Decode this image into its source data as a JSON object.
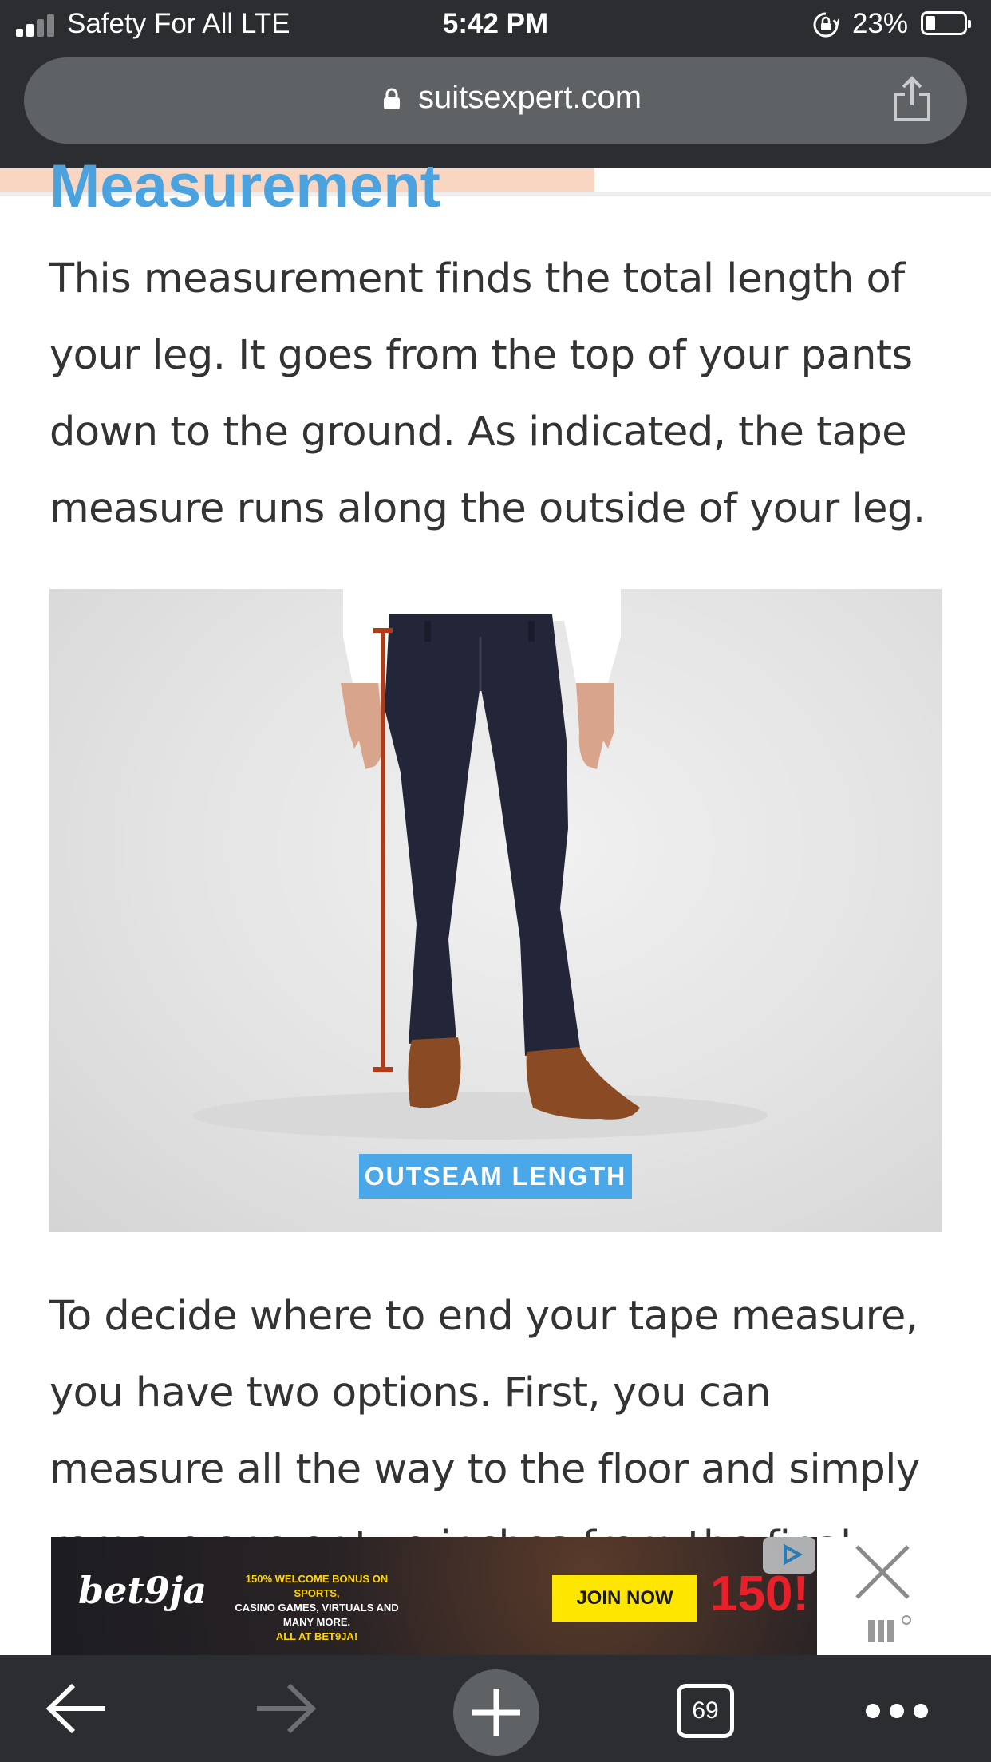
{
  "status_bar": {
    "carrier": "Safety For All  LTE",
    "time": "5:42 PM",
    "battery_percent": "23%",
    "battery_level": 0.23,
    "signal_bars": 2
  },
  "browser": {
    "url": "suitsexpert.com"
  },
  "article": {
    "reading_progress": 0.6,
    "heading": "Measurement",
    "paragraph1": "This measurement finds the total length of your leg. It goes from the top of your pants down to the ground. As indicated, the tape measure runs along the outside of your leg.",
    "image_label": "OUTSEAM LENGTH",
    "paragraph2": "To decide where to end your tape measure, you have two options. First, you can measure all the way to the floor and simply remove one or two inches from the final"
  },
  "ad": {
    "logo": "bet9ja",
    "line1": "150% WELCOME BONUS ON SPORTS,",
    "line2": "CASINO GAMES, VIRTUALS AND MANY MORE.",
    "line3": "ALL AT BET9JA!",
    "cta": "JOIN NOW",
    "bonus": "150!"
  },
  "toolbar": {
    "tab_count": "69"
  },
  "colors": {
    "accent": "#4aa3df",
    "chrome": "#2b2d30",
    "url_bar": "#5e6265",
    "progress": "#f8d6c2"
  }
}
